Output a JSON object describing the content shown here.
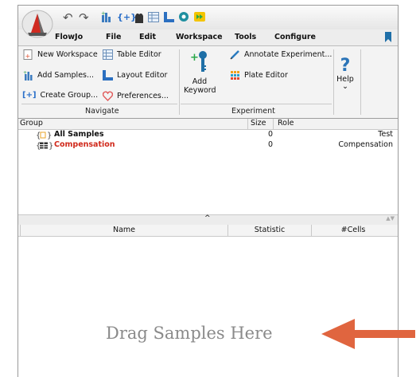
{
  "menu_tabs": [
    "FlowJo",
    "File",
    "Edit",
    "Workspace",
    "Tools",
    "Configure"
  ],
  "navigate": {
    "group_label": "Navigate",
    "new_workspace": "New Workspace",
    "add_samples": "Add Samples...",
    "create_group": "Create Group...",
    "table_editor": "Table Editor",
    "layout_editor": "Layout Editor",
    "preferences": "Preferences..."
  },
  "experiment": {
    "group_label": "Experiment",
    "add_keyword_line1": "Add",
    "add_keyword_line2": "Keyword",
    "annotate": "Annotate Experiment...",
    "plate_editor": "Plate Editor"
  },
  "help": {
    "label": "Help",
    "chevron": "⌄"
  },
  "group_table": {
    "headers": {
      "group": "Group",
      "size": "Size",
      "role": "Role"
    },
    "rows": [
      {
        "name": "All Samples",
        "size": "0",
        "role": "Test",
        "color": "#111111"
      },
      {
        "name": "Compensation",
        "size": "0",
        "role": "Compensation",
        "color": "#d0291b"
      }
    ]
  },
  "splitter_caret": "^",
  "sample_table": {
    "headers": {
      "name": "Name",
      "statistic": "Statistic",
      "cells": "#Cells"
    }
  },
  "drop_hint": "Drag Samples Here",
  "colors": {
    "accent_red": "#d0291b",
    "arrow": "#e0653f"
  }
}
